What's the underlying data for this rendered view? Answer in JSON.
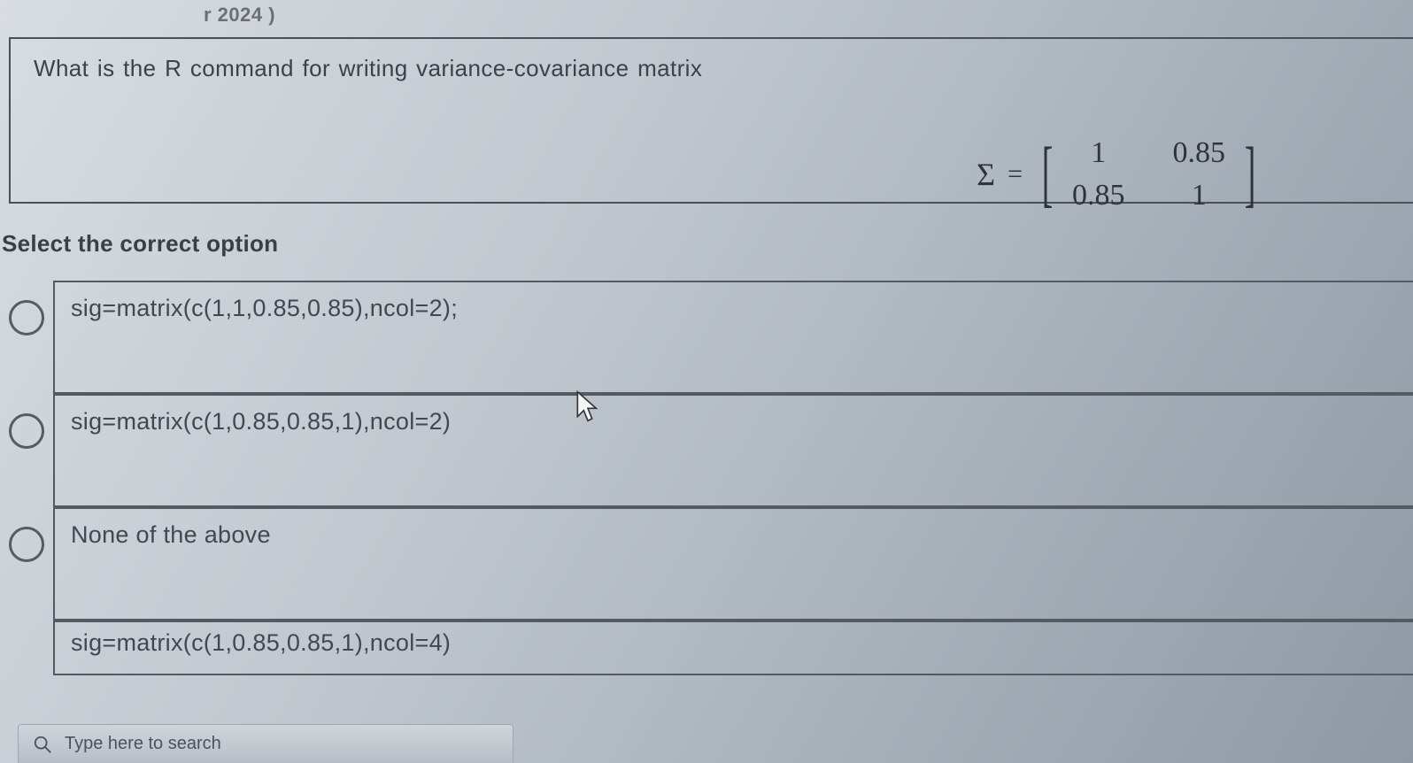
{
  "header_fragment": "r 2024 )",
  "question": {
    "text": "What is the R command for writing variance-covariance matrix",
    "matrix": {
      "symbol": "Σ",
      "equals": "=",
      "cells": [
        "1",
        "0.85",
        "0.85",
        "1"
      ]
    }
  },
  "instruction": "Select the correct option",
  "options": [
    {
      "text": "sig=matrix(c(1,1,0.85,0.85),ncol=2);"
    },
    {
      "text": "sig=matrix(c(1,0.85,0.85,1),ncol=2)"
    },
    {
      "text": "None of the above"
    },
    {
      "text": "sig=matrix(c(1,0.85,0.85,1),ncol=4)"
    }
  ],
  "taskbar": {
    "search_placeholder": "Type here to search"
  }
}
